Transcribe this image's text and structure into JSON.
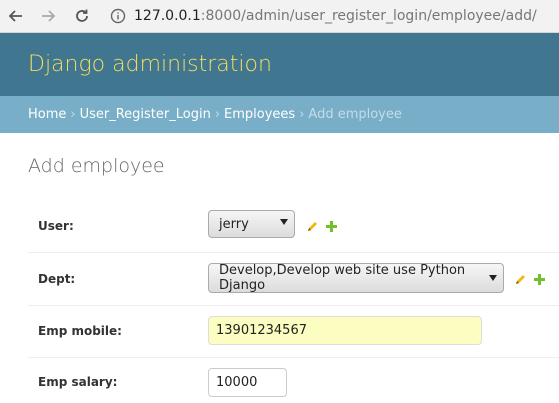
{
  "browser": {
    "url_host": "127.0.0.1",
    "url_rest": ":8000/admin/user_register_login/employee/add/",
    "icons": [
      "back-arrow-icon",
      "forward-arrow-icon",
      "reload-icon",
      "info-icon"
    ]
  },
  "header": {
    "branding": "Django administration",
    "colors": {
      "header_bg": "#417690",
      "branding_text": "#f5dd5d",
      "breadcrumbs_bg": "#79aec8"
    }
  },
  "breadcrumbs": {
    "home": "Home",
    "app": "User_Register_Login",
    "model": "Employees",
    "current": "Add employee",
    "separator": "›"
  },
  "page": {
    "title": "Add employee"
  },
  "form": {
    "user": {
      "label": "User:",
      "value": "jerry"
    },
    "dept": {
      "label": "Dept:",
      "value": "Develop,Develop web site use Python Django"
    },
    "emp_mobile": {
      "label": "Emp mobile:",
      "value": "13901234567"
    },
    "emp_salary": {
      "label": "Emp salary:",
      "value": "10000"
    }
  }
}
